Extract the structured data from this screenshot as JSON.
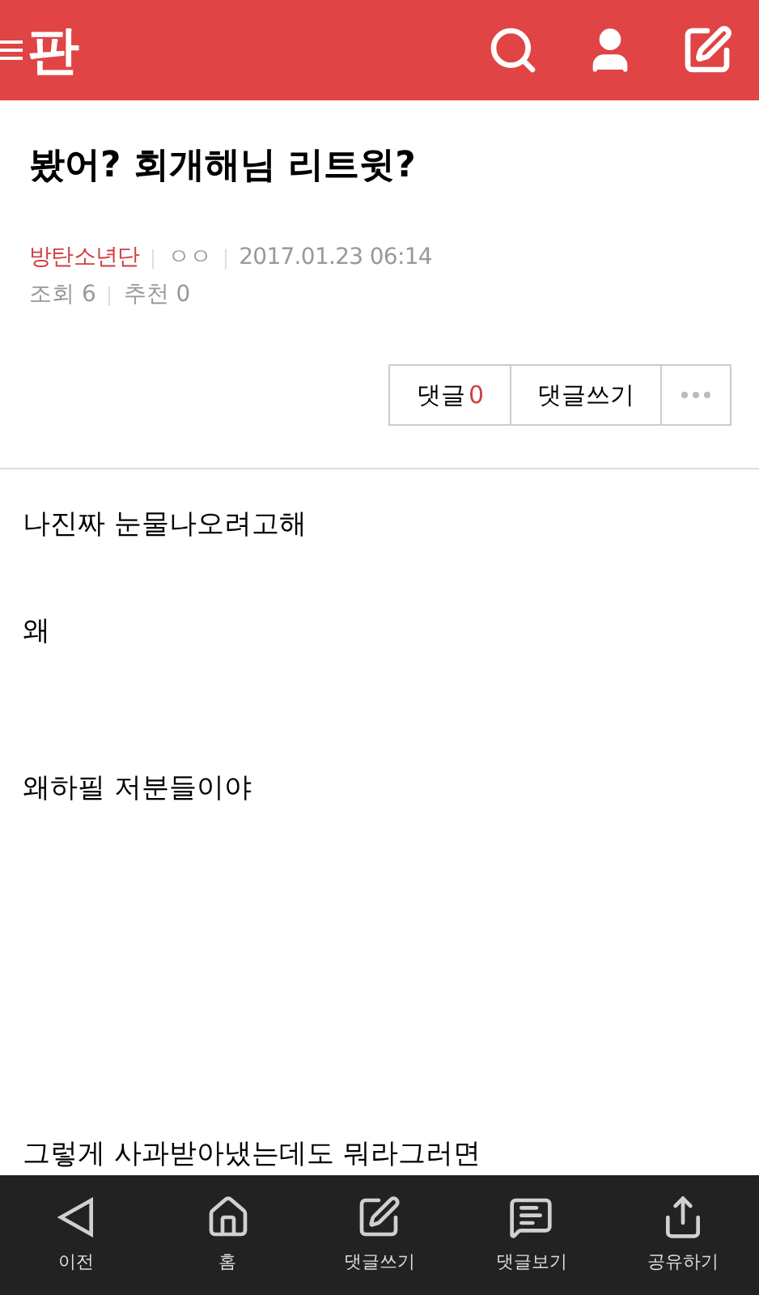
{
  "header": {
    "logo": "판"
  },
  "post": {
    "title": "봤어? 회개해님 리트윗?",
    "board": "방탄소년단",
    "author": "ㅇㅇ",
    "date": "2017.01.23 06:14",
    "views": "조회 6",
    "likes": "추천 0"
  },
  "actions": {
    "comments_label": "댓글",
    "comments_count": "0",
    "write": "댓글쓰기"
  },
  "body": [
    "나진짜 눈물나오려고해",
    "왜",
    "왜하필 저분들이야",
    "그렇게 사과받아냈는데도 뭐라그러면"
  ],
  "bottom_nav": [
    {
      "kind": "back",
      "label": "이전"
    },
    {
      "kind": "home",
      "label": "홈"
    },
    {
      "kind": "write",
      "label": "댓글쓰기"
    },
    {
      "kind": "view",
      "label": "댓글보기"
    },
    {
      "kind": "share",
      "label": "공유하기"
    }
  ]
}
